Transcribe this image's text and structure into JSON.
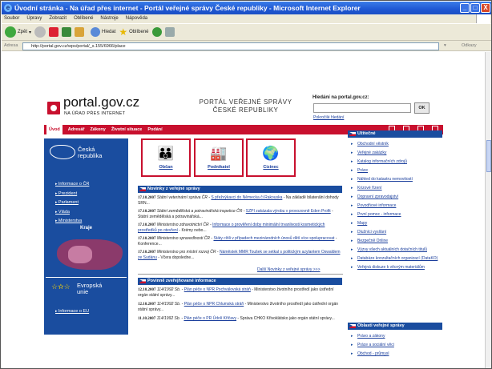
{
  "window": {
    "title": "Úvodní stránka - Na úřad přes internet - Portál veřejné správy České republiky - Microsoft Internet Explorer",
    "icon": "ie-logo-icon",
    "controls": [
      "_",
      "□",
      "X"
    ]
  },
  "menu": [
    "Soubor",
    "Úpravy",
    "Zobrazit",
    "Oblíbené",
    "Nástroje",
    "Nápověda"
  ],
  "toolbar": {
    "back": "Zpět",
    "search": "Hledat",
    "favorites": "Oblíbené"
  },
  "address": {
    "label": "Adresa",
    "url": "http://portal.gov.cz/wps/portal/_s.155/6966/place",
    "links": "Odkazy"
  },
  "site": {
    "logo": "portal.gov.cz",
    "logo_sub": "NA ÚŘAD PŘES INTERNET",
    "title_line1": "PORTÁL VEŘEJNÉ SPRÁVY",
    "title_line2": "ČESKÉ REPUBLIKY",
    "search_label": "Hledání na portal.gov.cz:",
    "search_button": "OK",
    "search_advanced": "Pokročilé hledání"
  },
  "nav": [
    "Úvod",
    "Adresář",
    "Zákony",
    "Životní situace",
    "Podání"
  ],
  "left": {
    "cz_title_1": "Česká",
    "cz_title_2": "republika",
    "links": [
      "Informace o ČR",
      "Prezident",
      "Parlament",
      "Vláda",
      "Ministerstva"
    ],
    "kraje": "Kraje",
    "eu_title_1": "Evropská",
    "eu_title_2": "unie",
    "eu_link": "Informace o EU"
  },
  "categories": [
    {
      "label": "Občan",
      "icon": "people-icon"
    },
    {
      "label": "Podnikatel",
      "icon": "factory-icon"
    },
    {
      "label": "Cizinec",
      "icon": "globe-icon"
    }
  ],
  "news_head": "Novinky z veřejné správy",
  "news": [
    {
      "date": "17.10.2007",
      "text": "Státní veterinární správa ČR - ",
      "link": "S přežvýkavci do Německa či Rakouska",
      "rest": " - Na základě bilaterální dohody SRN..."
    },
    {
      "date": "17.10.2007",
      "text": "Státní zemědělská a potravinářská inspekce ČR - ",
      "link": "SZPI zakázala výrobu v provozovně Eden Profit",
      "rest": " - Státní zemědělská a potravinářská..."
    },
    {
      "date": "17.10.2007",
      "text": "Ministerstvo zdravotnictví ČR - ",
      "link": "Informace o prověření doby minimální trvanlivosti kosmetických prostředků po otevření",
      "rest": " - Krémy nebo..."
    },
    {
      "date": "17.10.2007",
      "text": "Ministerstvo spravedlnosti ČR - ",
      "link": "Státy cítili v případech mezinárodních únosů dětí více spolupracovat",
      "rest": " - Konference..."
    },
    {
      "date": "17.10.2007",
      "text": "Ministerstvo pro místní rozvoj ČR - ",
      "link": "Náměstek MMR Toušek se setkal s politickým azylantem Oswaldem ze Sudánu",
      "rest": " - Včera dopoledne..."
    }
  ],
  "news_more": "Další Novinky z veřejné správy >>>",
  "info_head": "Povinně zveřejňované informace",
  "info": [
    {
      "date": "12.10.2007",
      "text": "114/1992 Sb. - ",
      "link": "Plán péče o NPR Pochválovská stráň",
      "rest": " - Ministerstvo životního prostředí jako ústřední orgán státní správy..."
    },
    {
      "date": "12.10.2007",
      "text": "114/1992 Sb. - ",
      "link": "Plán péče o NPR Chlumská stráň",
      "rest": " - Ministerstvo životního prostředí jako ústřední orgán státní správy..."
    },
    {
      "date": "11.10.2007",
      "text": "114/1992 Sb. - ",
      "link": "Plán péče o PR Údolí Křičavy",
      "rest": " - Správa CHKO Křivoklátsko jako orgán státní správy..."
    }
  ],
  "useful_head": "Užitečné",
  "useful": [
    "Obchodní věstník",
    "Veřejné zakázky",
    "Katalog informačních zdrojů",
    "Práce",
    "Náhled do katastru nemovitostí",
    "Krizové řízení",
    "Dopravní zpravodajství",
    "Povodňové informace",
    "První pomoc - informace",
    "Mapy",
    "Dlužníci vysílání",
    "Bezpečně Online",
    "Výzvy všech aktuálních dotačních titulů",
    "Databáze konzultačních organizací (DataKO)",
    "Veřejná diskuze k věcným materiálům"
  ],
  "areas_head": "Oblasti veřejné správy",
  "areas": [
    "Právo a zákony",
    "Práce a sociální věci",
    "Obchod - průmysl"
  ],
  "colors": {
    "brand_red": "#c8102e",
    "brand_blue": "#1a4d9f",
    "link": "#1a3e9c"
  }
}
